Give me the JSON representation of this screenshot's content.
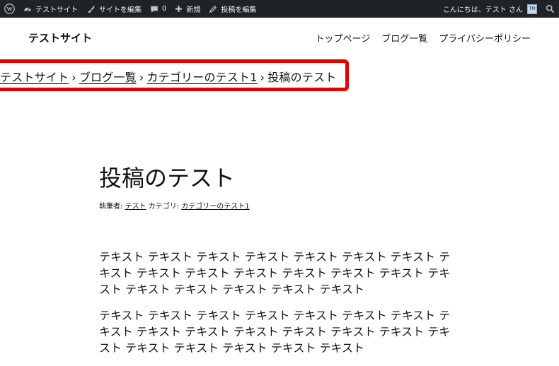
{
  "adminbar": {
    "site_name": "テストサイト",
    "customize": "サイトを編集",
    "comments_count": "0",
    "new": "新規",
    "edit_post": "投稿を編集",
    "greeting": "こんにちは、テスト さん",
    "avatar_text": "TM"
  },
  "header": {
    "site_title": "テストサイト",
    "nav": [
      "トップページ",
      "ブログ一覧",
      "プライバシーポリシー"
    ]
  },
  "breadcrumb": {
    "items": [
      "テストサイト",
      "ブログ一覧",
      "カテゴリーのテスト1"
    ],
    "current": "投稿のテスト",
    "separator": "›"
  },
  "post": {
    "title": "投稿のテスト",
    "meta": {
      "author_label": "執筆者:",
      "author": "テスト",
      "category_label": "カテゴリ:",
      "category": "カテゴリーのテスト1"
    },
    "paragraphs": [
      "テキスト テキスト テキスト テキスト テキスト テキスト テキスト テキスト テキスト テキスト テキスト テキスト テキスト テキスト テキスト テキスト テキスト テキスト テキスト テキスト",
      "テキスト テキスト テキスト テキスト テキスト テキスト テキスト テキスト テキスト テキスト テキスト テキスト テキスト テキスト テキスト テキスト テキスト テキスト テキスト テキスト"
    ]
  },
  "colors": {
    "adminbar_bg": "#1d2327",
    "highlight_border": "#e60000"
  }
}
